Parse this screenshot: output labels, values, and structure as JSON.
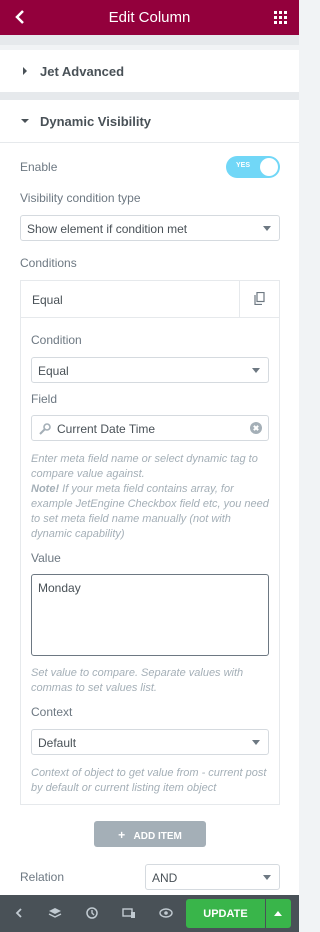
{
  "header": {
    "title": "Edit Column"
  },
  "sections": {
    "jet_advanced": "Jet Advanced",
    "dynamic_visibility": "Dynamic Visibility"
  },
  "enable": {
    "label": "Enable",
    "toggle_text": "YES",
    "checked": true
  },
  "visibility_type": {
    "label": "Visibility condition type",
    "value": "Show element if condition met"
  },
  "conditions": {
    "label": "Conditions",
    "item_title": "Equal",
    "condition_label": "Condition",
    "condition_value": "Equal",
    "field_label": "Field",
    "field_value": "Current Date Time",
    "field_desc_1": "Enter meta field name or select dynamic tag to compare value against.",
    "field_note_bold": "Note!",
    "field_desc_2": "If your meta field contains array, for example JetEngine Checkbox field etc, you need to set meta field name manually (not with dynamic capability)",
    "value_label": "Value",
    "value_text": "Monday",
    "value_desc": "Set value to compare. Separate values with commas to set values list.",
    "context_label": "Context",
    "context_value": "Default",
    "context_desc": "Context of object to get value from - current post by default or current listing item object",
    "add_item": "ADD ITEM"
  },
  "relation": {
    "label": "Relation",
    "value": "AND"
  },
  "footer": {
    "update": "UPDATE"
  },
  "colors": {
    "header": "#93003c",
    "update": "#39b54a",
    "toggle": "#71d7f7"
  }
}
